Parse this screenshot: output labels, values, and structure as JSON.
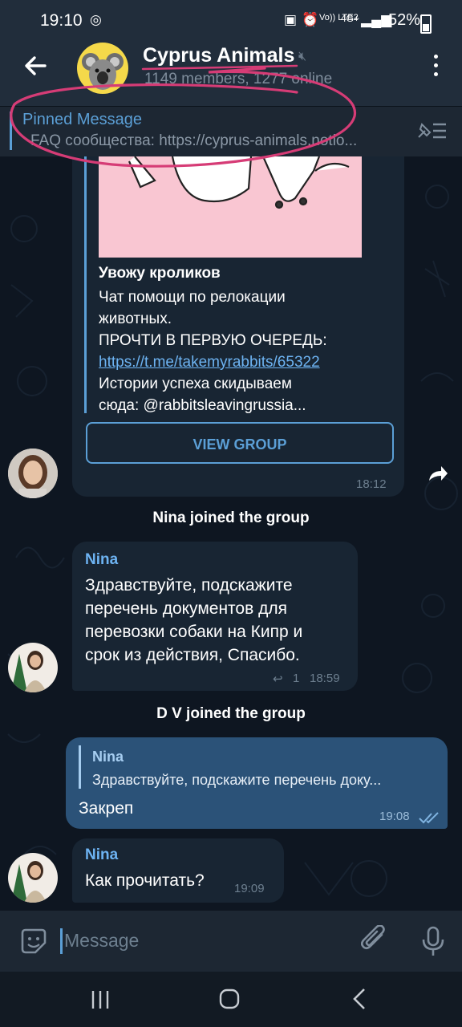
{
  "status_bar": {
    "time": "19:10",
    "network": "Vo)) LTE2",
    "signal": "4G+",
    "battery": "52%"
  },
  "header": {
    "title": "Cyprus Animals",
    "subtitle": "1149 members, 1277 online"
  },
  "pinned": {
    "title": "Pinned Message",
    "text": "FAQ сообщества:  https://cyprus-animals.notio..."
  },
  "messages": {
    "link_preview": {
      "title": "Увожу кроликов",
      "line1": "Чат помощи по релокации",
      "line2": "животных.",
      "line3": "ПРОЧТИ В ПЕРВУЮ ОЧЕРЕДЬ:",
      "link": "https://t.me/takemyrabbits/65322",
      "line4": "Истории успеха скидываем",
      "line5": "сюда: @rabbitsleavingrussia...",
      "button": "VIEW GROUP",
      "time": "18:12"
    },
    "service1": "Nina joined the group",
    "msg_nina": {
      "sender": "Nina",
      "line1": "Здравствуйте, подскажите",
      "line2": "перечень документов для",
      "line3": "перевозки собаки на Кипр и",
      "line4": "срок из действия, Спасибо.",
      "replies": "1",
      "time": "18:59"
    },
    "service2": "D V joined the group",
    "msg_out": {
      "quote_name": "Nina",
      "quote_text": "Здравствуйте, подскажите перечень доку...",
      "text": "Закреп",
      "time": "19:08"
    },
    "msg_nina2": {
      "sender": "Nina",
      "text": "Как прочитать?",
      "time": "19:09"
    }
  },
  "input": {
    "placeholder": "Message"
  },
  "colors": {
    "bg": "#0e1621",
    "header": "#212d3b",
    "bubble_in": "#182533",
    "bubble_out": "#2b5278",
    "accent": "#5b9fd6"
  }
}
